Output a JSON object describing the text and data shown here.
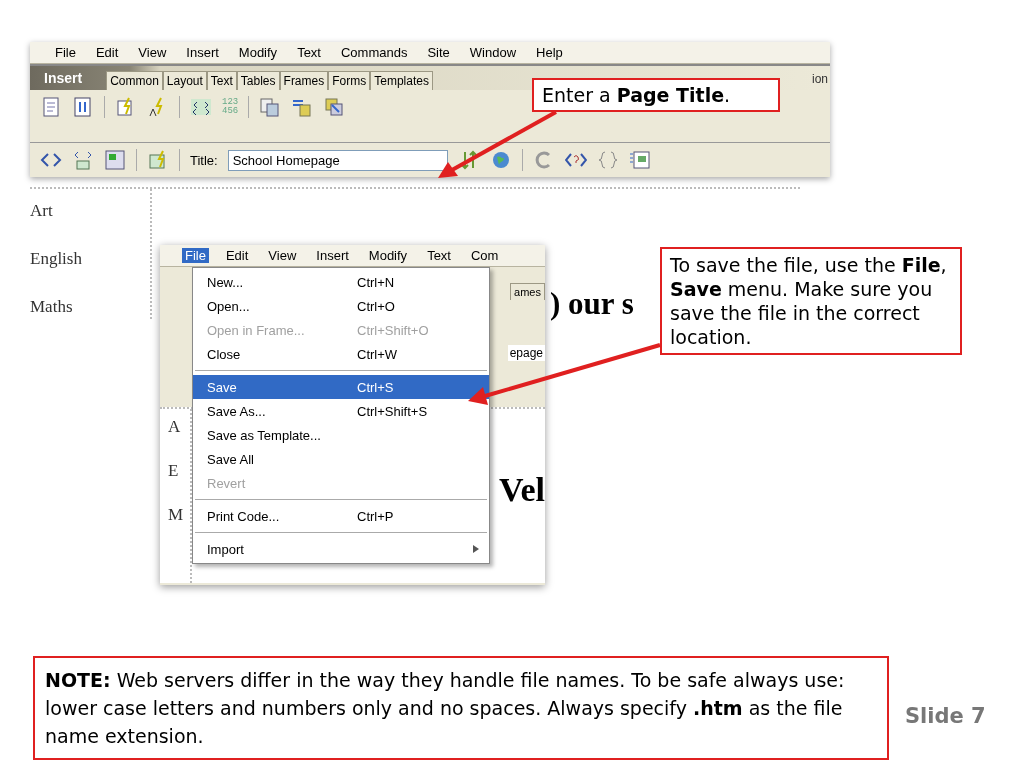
{
  "editor_window": {
    "menu": [
      "File",
      "Edit",
      "View",
      "Insert",
      "Modify",
      "Text",
      "Commands",
      "Site",
      "Window",
      "Help"
    ],
    "insert_bar": {
      "label": "Insert",
      "tabs": [
        "Common",
        "Layout",
        "Text",
        "Tables",
        "Frames",
        "Forms",
        "Templates"
      ],
      "tab_fragment": "ion"
    },
    "number_icon_text": [
      "123",
      "456"
    ],
    "title_field": {
      "label": "Title:",
      "value": "School Homepage"
    },
    "page_links": [
      "Art",
      "English",
      "Maths"
    ],
    "heading_fragment": ") our s"
  },
  "menu_window": {
    "menu": [
      {
        "label": "File",
        "selected": true
      },
      {
        "label": "Edit",
        "selected": false
      },
      {
        "label": "View",
        "selected": false
      },
      {
        "label": "Insert",
        "selected": false
      },
      {
        "label": "Modify",
        "selected": false
      },
      {
        "label": "Text",
        "selected": false
      },
      {
        "label": "Com",
        "selected": false
      }
    ],
    "tab_fragment": "ames",
    "field_fragment": "epage",
    "link_fragments": [
      "A",
      "E",
      "M"
    ],
    "heading_fragment": "Vel",
    "file_menu": [
      {
        "kind": "item",
        "label": "New...",
        "shortcut": "Ctrl+N",
        "disabled": false,
        "selected": false
      },
      {
        "kind": "item",
        "label": "Open...",
        "shortcut": "Ctrl+O",
        "disabled": false,
        "selected": false
      },
      {
        "kind": "item",
        "label": "Open in Frame...",
        "shortcut": "Ctrl+Shift+O",
        "disabled": true,
        "selected": false
      },
      {
        "kind": "item",
        "label": "Close",
        "shortcut": "Ctrl+W",
        "disabled": false,
        "selected": false
      },
      {
        "kind": "separator"
      },
      {
        "kind": "item",
        "label": "Save",
        "shortcut": "Ctrl+S",
        "disabled": false,
        "selected": true
      },
      {
        "kind": "item",
        "label": "Save As...",
        "shortcut": "Ctrl+Shift+S",
        "disabled": false,
        "selected": false
      },
      {
        "kind": "item",
        "label": "Save as Template...",
        "disabled": false,
        "selected": false
      },
      {
        "kind": "item",
        "label": "Save All",
        "disabled": false,
        "selected": false
      },
      {
        "kind": "item",
        "label": "Revert",
        "disabled": true,
        "selected": false
      },
      {
        "kind": "separator"
      },
      {
        "kind": "item",
        "label": "Print Code...",
        "shortcut": "Ctrl+P",
        "disabled": false,
        "selected": false
      },
      {
        "kind": "separator"
      },
      {
        "kind": "submenu",
        "label": "Import",
        "disabled": false,
        "selected": false
      }
    ]
  },
  "title_callout": "Enter a **Page Title**.",
  "save_callout": "To save the file, use the **File**, **Save** menu. Make sure you save the file in the correct location.",
  "note": "**NOTE:** Web servers differ in the way they handle file names. To be safe always use: lower case letters and numbers only and no spaces. Always specify **.htm** as the file name extension.",
  "slide_number": "Slide 7"
}
